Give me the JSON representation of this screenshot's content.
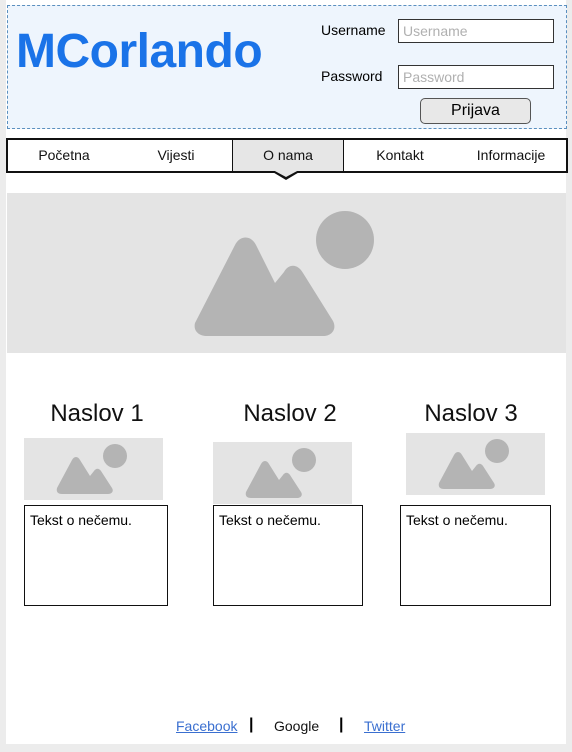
{
  "header": {
    "logo": "MCorlando",
    "username_label": "Username",
    "username_placeholder": "Username",
    "password_label": "Password",
    "password_placeholder": "Password",
    "login_button": "Prijava"
  },
  "nav": {
    "items": [
      {
        "label": "Početna"
      },
      {
        "label": "Vijesti"
      },
      {
        "label": "O nama"
      },
      {
        "label": "Kontakt"
      },
      {
        "label": "Informacije"
      }
    ]
  },
  "columns": [
    {
      "title": "Naslov 1",
      "text": "Tekst o nečemu."
    },
    {
      "title": "Naslov 2",
      "text": "Tekst o nečemu."
    },
    {
      "title": "Naslov 3",
      "text": "Tekst o nečemu."
    }
  ],
  "footer": {
    "facebook": "Facebook",
    "google": "Google",
    "twitter": "Twitter",
    "separator": "|"
  },
  "colors": {
    "brand": "#1a73e8",
    "header_bg": "#eef5fd",
    "placeholder_bg": "#e4e4e4",
    "link": "#3a6fd0"
  }
}
